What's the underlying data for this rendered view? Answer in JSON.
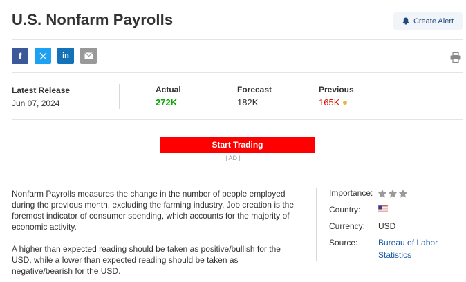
{
  "header": {
    "title": "U.S. Nonfarm Payrolls",
    "create_alert_label": "Create Alert"
  },
  "share": {
    "icons": [
      "facebook-icon",
      "x-twitter-icon",
      "linkedin-icon",
      "email-icon"
    ],
    "print_icon": "print-icon"
  },
  "release": {
    "latest_label": "Latest Release",
    "latest_date": "Jun 07, 2024",
    "actual_label": "Actual",
    "actual_value": "272K",
    "forecast_label": "Forecast",
    "forecast_value": "182K",
    "previous_label": "Previous",
    "previous_value": "165K"
  },
  "trade": {
    "button_label": "Start Trading",
    "ad_label": "| AD |"
  },
  "description": {
    "paragraph1": "Nonfarm Payrolls measures the change in the number of people employed during the previous month, excluding the farming industry. Job creation is the foremost indicator of consumer spending, which accounts for the majority of economic activity.",
    "paragraph2": "A higher than expected reading should be taken as positive/bullish for the USD, while a lower than expected reading should be taken as negative/bearish for the USD."
  },
  "meta": {
    "importance_label": "Importance:",
    "importance_stars": 3,
    "country_label": "Country:",
    "country_flag": "us-flag-icon",
    "currency_label": "Currency:",
    "currency_value": "USD",
    "source_label": "Source:",
    "source_value": "Bureau of Labor Statistics"
  },
  "colors": {
    "actual": "#0ea600",
    "previous": "#d91400",
    "trade_button": "#ff0000",
    "link": "#1b5da8"
  }
}
